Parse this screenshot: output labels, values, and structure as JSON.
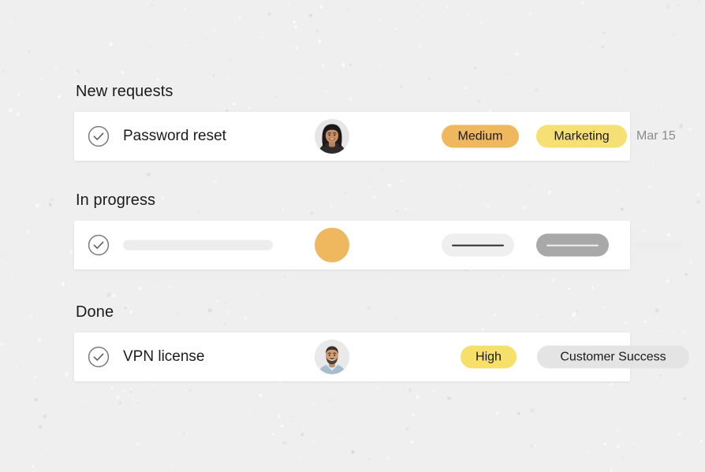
{
  "page": {
    "background_color": "#efefef",
    "card_background": "#ffffff"
  },
  "palette": {
    "priority_medium": "#efb75e",
    "priority_high": "#f7e06a",
    "tag_marketing": "#f6e074",
    "tag_customer_success": "#e4e4e4",
    "text_primary": "#1b1b1b",
    "text_muted": "#8b8b8b",
    "skeleton_light": "#ededed",
    "skeleton_dark": "#a8a8a8",
    "check_icon": "#7a7a7a"
  },
  "sections": [
    {
      "id": "new-requests",
      "title": "New requests",
      "row": {
        "state": "loaded",
        "check_icon": "check-circle-icon",
        "title": "Password reset",
        "avatar": {
          "name": "avatar-woman",
          "alt": "Assignee avatar"
        },
        "priority": {
          "label": "Medium",
          "color": "#efb75e"
        },
        "tag": {
          "label": "Marketing",
          "color": "#f6e074"
        },
        "date": "Mar 15"
      }
    },
    {
      "id": "in-progress",
      "title": "In progress",
      "row": {
        "state": "loading",
        "check_icon": "check-circle-icon",
        "title_placeholder": "",
        "avatar_placeholder_color": "#efb75e",
        "pill_one_color": "#efefef",
        "pill_one_line_color": "#2b2b2b",
        "pill_two_color": "#a8a8a8",
        "pill_two_line_color": "#f2f2f2",
        "bar_color": "#ececec"
      }
    },
    {
      "id": "done",
      "title": "Done",
      "row": {
        "state": "loaded",
        "check_icon": "check-circle-icon",
        "title": "VPN license",
        "avatar": {
          "name": "avatar-man",
          "alt": "Assignee avatar"
        },
        "priority": {
          "label": "High",
          "color": "#f7e06a"
        },
        "tag": {
          "label": "Customer Success",
          "color": "#e4e4e4"
        },
        "date": ""
      }
    }
  ]
}
